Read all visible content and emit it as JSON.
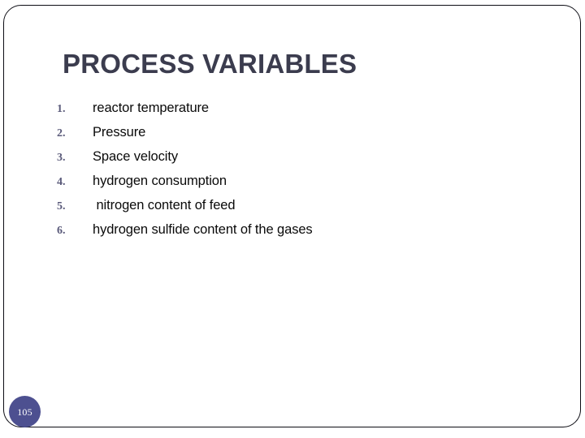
{
  "slide": {
    "title": "PROCESS VARIABLES",
    "page_number": "105",
    "colors": {
      "title": "#3b3c4e",
      "list_number": "#5a5a7a",
      "list_text": "#0a0a0a",
      "badge_background": "#4d5090",
      "badge_text": "#ffffff",
      "border": "#0d0d14",
      "background": "#ffffff"
    },
    "items": [
      {
        "number": "1.",
        "text": "reactor temperature"
      },
      {
        "number": "2.",
        "text": "Pressure"
      },
      {
        "number": "3.",
        "text": "Space velocity"
      },
      {
        "number": "4.",
        "text": "hydrogen consumption"
      },
      {
        "number": "5.",
        "text": " nitrogen content of feed"
      },
      {
        "number": "6.",
        "text": "hydrogen sulfide content of the gases"
      }
    ]
  }
}
